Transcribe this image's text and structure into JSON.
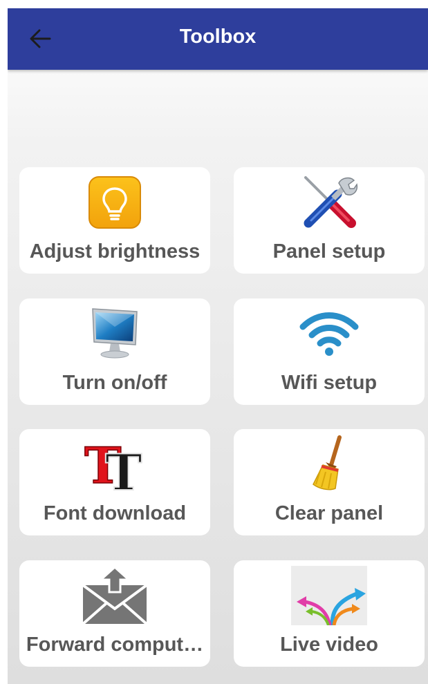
{
  "appbar": {
    "title": "Toolbox",
    "back_icon": "arrow-left-icon",
    "background": "#2e3e9c"
  },
  "tiles": [
    {
      "label": "Adjust brightness",
      "icon": "lightbulb-icon"
    },
    {
      "label": "Panel setup",
      "icon": "tools-icon"
    },
    {
      "label": "Turn on/off",
      "icon": "monitor-icon"
    },
    {
      "label": "Wifi setup",
      "icon": "wifi-icon"
    },
    {
      "label": "Font download",
      "icon": "font-icon"
    },
    {
      "label": "Clear panel",
      "icon": "broom-icon"
    },
    {
      "label": "Forward comput…",
      "icon": "mail-forward-icon"
    },
    {
      "label": "Live video",
      "icon": "arrows-icon"
    }
  ],
  "colors": {
    "tile_background": "#ffffff",
    "label_text": "#575757",
    "accent_wifi": "#2a8fc9"
  }
}
